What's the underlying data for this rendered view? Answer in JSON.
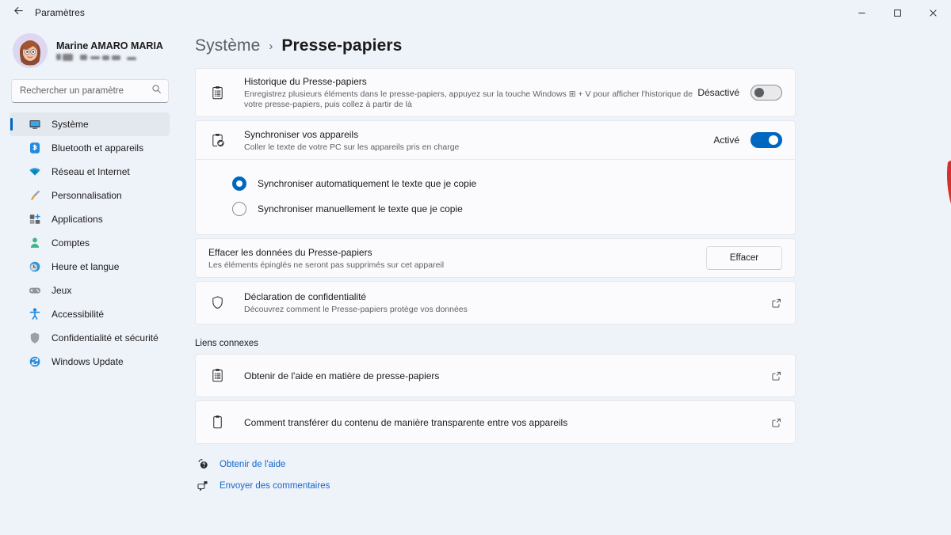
{
  "window": {
    "title": "Paramètres",
    "back_icon": "arrow-left-icon",
    "minimize_label": "—",
    "maximize_label": "□",
    "close_label": "✕"
  },
  "sidebar": {
    "account": {
      "name": "Marine AMARO MARIA",
      "email_redacted": true,
      "avatar_icon": "avatar-woman-icon"
    },
    "search": {
      "placeholder": "Rechercher un paramètre",
      "value": "",
      "icon": "search-icon"
    },
    "items": [
      {
        "label": "Système",
        "icon": "monitor-icon",
        "active": true
      },
      {
        "label": "Bluetooth et appareils",
        "icon": "bluetooth-icon",
        "active": false
      },
      {
        "label": "Réseau et Internet",
        "icon": "wifi-icon",
        "active": false
      },
      {
        "label": "Personnalisation",
        "icon": "paintbrush-icon",
        "active": false
      },
      {
        "label": "Applications",
        "icon": "apps-icon",
        "active": false
      },
      {
        "label": "Comptes",
        "icon": "person-icon",
        "active": false
      },
      {
        "label": "Heure et langue",
        "icon": "clock-globe-icon",
        "active": false
      },
      {
        "label": "Jeux",
        "icon": "gamepad-icon",
        "active": false
      },
      {
        "label": "Accessibilité",
        "icon": "accessibility-icon",
        "active": false
      },
      {
        "label": "Confidentialité et sécurité",
        "icon": "shield-icon",
        "active": false
      },
      {
        "label": "Windows Update",
        "icon": "update-icon",
        "active": false
      }
    ]
  },
  "breadcrumb": {
    "parent": "Système",
    "separator": "›",
    "current": "Presse-papiers"
  },
  "main": {
    "clipboard_history": {
      "icon": "clipboard-list-icon",
      "title": "Historique du Presse-papiers",
      "subtitle": "Enregistrez plusieurs éléments dans le presse-papiers, appuyez sur la touche Windows ⊞ + V pour afficher l'historique de votre presse-papiers, puis collez à partir de là",
      "state_label": "Désactivé",
      "toggle_on": false
    },
    "sync_devices": {
      "icon": "clipboard-sync-icon",
      "title": "Synchroniser vos appareils",
      "subtitle": "Coller le texte de votre PC sur les appareils pris en charge",
      "state_label": "Activé",
      "toggle_on": true,
      "options": [
        {
          "label": "Synchroniser automatiquement le texte que je copie",
          "checked": true
        },
        {
          "label": "Synchroniser manuellement le texte que je copie",
          "checked": false
        }
      ]
    },
    "clear_data": {
      "title": "Effacer les données du Presse-papiers",
      "subtitle": "Les éléments épinglés ne seront pas supprimés sur cet appareil",
      "button_label": "Effacer"
    },
    "privacy": {
      "icon": "shield-outline-icon",
      "title": "Déclaration de confidentialité",
      "subtitle": "Découvrez comment le Presse-papiers protège vos données",
      "external_icon": "external-link-icon"
    },
    "related_links_title": "Liens connexes",
    "related_links": [
      {
        "label": "Obtenir de l'aide en matière de presse-papiers",
        "icon": "clipboard-list-icon",
        "external_icon": "external-link-icon"
      },
      {
        "label": "Comment transférer du contenu de manière transparente entre vos appareils",
        "icon": "clipboard-icon",
        "external_icon": "external-link-icon"
      }
    ],
    "footer_links": [
      {
        "label": "Obtenir de l'aide",
        "icon": "help-icon"
      },
      {
        "label": "Envoyer des commentaires",
        "icon": "feedback-icon"
      }
    ]
  },
  "annotation": {
    "type": "curved-arrow",
    "color": "#d5302a",
    "points_at": "sync-devices-toggle"
  },
  "colors": {
    "accent": "#0067c0",
    "page_background": "#eef2f9",
    "card_background": "#fbfbfd",
    "link": "#1667c8",
    "annotation_red": "#d5302a"
  }
}
